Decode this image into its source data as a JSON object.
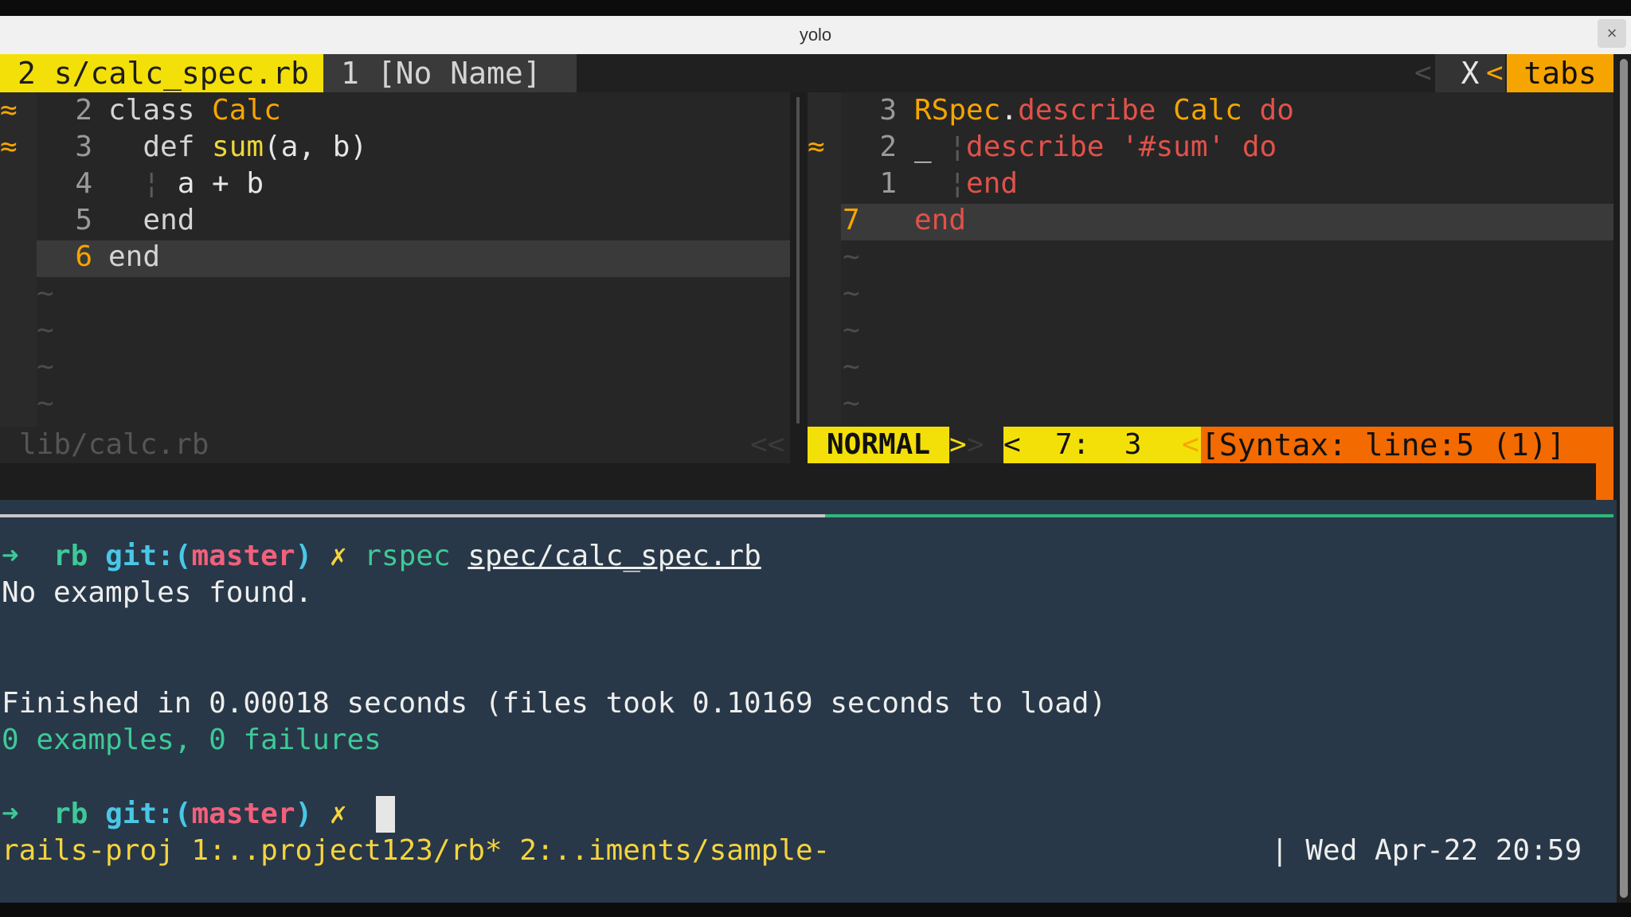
{
  "window": {
    "title": "yolo",
    "close_label": "×"
  },
  "tabline": {
    "active_tab": "2 s/calc_spec.rb",
    "inactive_tab": "1 [No Name]",
    "close_label": "X",
    "tabs_label": "tabs"
  },
  "left_pane": {
    "lines": [
      {
        "num": "2",
        "sign": "≈",
        "code": [
          {
            "t": "class ",
            "c": "kw"
          },
          {
            "t": "Calc",
            "c": "cls"
          }
        ]
      },
      {
        "num": "3",
        "sign": "≈",
        "code": [
          {
            "t": "  def ",
            "c": "kw"
          },
          {
            "t": "sum",
            "c": "fn"
          },
          {
            "t": "(a, b)",
            "c": "txt"
          }
        ]
      },
      {
        "num": "4",
        "sign": "",
        "code": [
          {
            "t": "  ¦ ",
            "c": "guide"
          },
          {
            "t": "a + b",
            "c": "txt"
          }
        ]
      },
      {
        "num": "5",
        "sign": "",
        "code": [
          {
            "t": "  end",
            "c": "kw"
          }
        ]
      },
      {
        "num": "6",
        "sign": "",
        "code": [
          {
            "t": "end",
            "c": "kw"
          }
        ],
        "current": true
      }
    ],
    "tildes": 4,
    "filename": "lib/calc.rb"
  },
  "right_pane": {
    "lines": [
      {
        "num": "3",
        "sign": "",
        "code": [
          {
            "t": "RSpec",
            "c": "cls"
          },
          {
            "t": ".",
            "c": "txt"
          },
          {
            "t": "describe ",
            "c": "red"
          },
          {
            "t": "Calc ",
            "c": "cls"
          },
          {
            "t": "do",
            "c": "red"
          }
        ]
      },
      {
        "num": "2",
        "sign": "≈",
        "code": [
          {
            "t": "_ ",
            "c": "txt"
          },
          {
            "t": "¦",
            "c": "guide"
          },
          {
            "t": "describe ",
            "c": "red"
          },
          {
            "t": "'#sum' ",
            "c": "str"
          },
          {
            "t": "do",
            "c": "red"
          }
        ]
      },
      {
        "num": "1",
        "sign": "",
        "code": [
          {
            "t": "  ",
            "c": "txt"
          },
          {
            "t": "¦",
            "c": "guide"
          },
          {
            "t": "end",
            "c": "red"
          }
        ]
      },
      {
        "num": "7",
        "sign": "",
        "code": [
          {
            "t": "end",
            "c": "red"
          }
        ],
        "current": true
      }
    ],
    "tildes": 5
  },
  "statusline": {
    "mode": "NORMAL",
    "position": "<  7:  3",
    "syntax": "[Syntax: line:5 (1)]"
  },
  "terminal": {
    "prompt_arrow": "➜",
    "dir": "rb",
    "git_label": "git:(",
    "branch": "master",
    "git_close": ")",
    "dirty_mark": "✗",
    "command": "rspec",
    "command_arg": "spec/calc_spec.rb",
    "output_1": "No examples found.",
    "output_2": "Finished in 0.00018 seconds (files took 0.10169 seconds to load)",
    "output_3": "0 examples, 0 failures"
  },
  "tmux": {
    "left": "rails-proj 1:..project123/rb* 2:..iments/sample-",
    "right": "| Wed Apr-22 20:59"
  }
}
